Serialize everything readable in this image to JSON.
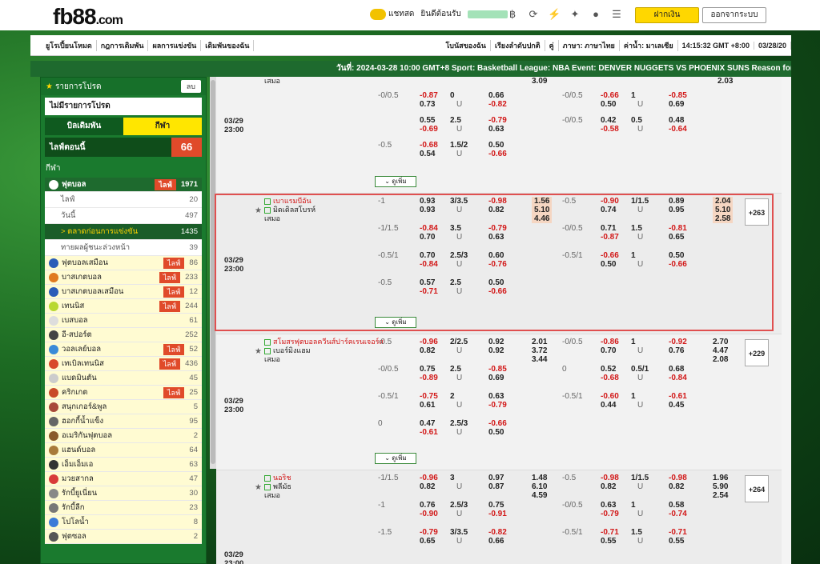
{
  "header": {
    "logo": "fb88",
    "logo_suffix": ".com",
    "chat": "แชทสด",
    "welcome": "ยินดีต้อนรับ",
    "deposit": "ฝากเงิน",
    "logout": "ออกจากระบบ"
  },
  "menu": [
    "ยูโรเปี้ยนโหมด",
    "กฎการเดิมพัน",
    "ผลการแข่งขัน",
    "เดิมพันของฉัน",
    "โบนัสของฉัน",
    "เรียงลำดับปกติ",
    "คู่",
    "ภาษา: ภาษาไทย",
    "ค่าน้ำ: มาเลเซีย",
    "14:15:32 GMT +8:00",
    "03/28/20"
  ],
  "ticker": "วันที่: 2024-03-28 10:00 GMT+8 Sport: Basketball League: NBA Event: DENVER NUGGETS VS PHOENIX SUNS Reason for cancellation",
  "sidebar": {
    "fav_title": "รายการโปรด",
    "fav_btn": "ลบ",
    "fav_empty": "ไม่มีรายการโปรด",
    "tab_bet": "บิลเดิมพัน",
    "tab_sport": "กีฬา",
    "live_label": "ไลฟ์ตอนนี้",
    "live_count": "66",
    "section": "กีฬา",
    "soccer": {
      "label": "ฟุตบอล",
      "live": "ไลฟ์",
      "count": "1971"
    },
    "sub": [
      {
        "label": "ไลฟ์",
        "count": "20"
      },
      {
        "label": "วันนี้",
        "count": "497"
      },
      {
        "label": "ตลาดก่อนการแข่งขัน",
        "count": "1435"
      },
      {
        "label": "ทายผลผู้ชนะล่วงหน้า",
        "count": "39"
      }
    ],
    "sports": [
      {
        "label": "ฟุตบอลเสมือน",
        "live": "ไลฟ์",
        "count": "86",
        "color": "#2a5cb8"
      },
      {
        "label": "บาสเกตบอล",
        "live": "ไลฟ์",
        "count": "233",
        "color": "#e07a20"
      },
      {
        "label": "บาสเกตบอลเสมือน",
        "live": "ไลฟ์",
        "count": "12",
        "color": "#2a5cb8"
      },
      {
        "label": "เทนนิส",
        "live": "ไลฟ์",
        "count": "244",
        "color": "#b8d830"
      },
      {
        "label": "เบสบอล",
        "live": "",
        "count": "61",
        "color": "#dddddd"
      },
      {
        "label": "อี-สปอร์ต",
        "live": "",
        "count": "252",
        "color": "#444444"
      },
      {
        "label": "วอลเลย์บอล",
        "live": "ไลฟ์",
        "count": "52",
        "color": "#3a8ad8"
      },
      {
        "label": "เทเบิลเทนนิส",
        "live": "ไลฟ์",
        "count": "436",
        "color": "#d84a2a"
      },
      {
        "label": "แบดมินตัน",
        "live": "",
        "count": "45",
        "color": "#cccccc"
      },
      {
        "label": "คริกเกต",
        "live": "ไลฟ์",
        "count": "25",
        "color": "#c84a2a"
      },
      {
        "label": "สนุกเกอร์&พูล",
        "live": "",
        "count": "5",
        "color": "#a84a3a"
      },
      {
        "label": "ฮอกกี้น้ำแข็ง",
        "live": "",
        "count": "95",
        "color": "#666666"
      },
      {
        "label": "อเมริกันฟุตบอล",
        "live": "",
        "count": "2",
        "color": "#8a5a2a"
      },
      {
        "label": "แฮนด์บอล",
        "live": "",
        "count": "64",
        "color": "#a87a3a"
      },
      {
        "label": "เอ็มเอ็มเอ",
        "live": "",
        "count": "63",
        "color": "#333333"
      },
      {
        "label": "มวยสากล",
        "live": "",
        "count": "47",
        "color": "#d83a3a"
      },
      {
        "label": "รักบี้ยูเนี่ยน",
        "live": "",
        "count": "30",
        "color": "#888888"
      },
      {
        "label": "รักบี้ลีก",
        "live": "",
        "count": "23",
        "color": "#777777"
      },
      {
        "label": "โปโลน้ำ",
        "live": "",
        "count": "8",
        "color": "#3a7ad8"
      },
      {
        "label": "ฟุตซอล",
        "live": "",
        "count": "2",
        "color": "#555555"
      }
    ]
  },
  "matches": [
    {
      "date": "03/29",
      "time": "23:00",
      "home": "",
      "away": "",
      "draw": "เสมอ",
      "more": "",
      "rows": [
        [
          "-0/0.5",
          "-0.87",
          "0.73",
          "0",
          "U",
          "0.66",
          "-0.82",
          "",
          "",
          "",
          "-0/0.5",
          "-0.66",
          "0.50",
          "1",
          "U",
          "-0.85",
          "0.69",
          "",
          "",
          ""
        ],
        [
          "",
          "0.55",
          "-0.69",
          "2.5",
          "U",
          "-0.79",
          "0.63",
          "",
          "",
          "",
          "-0/0.5",
          "0.42",
          "-0.58",
          "0.5",
          "U",
          "0.48",
          "-0.64",
          "",
          "",
          ""
        ],
        [
          "-0.5",
          "-0.68",
          "0.54",
          "1.5/2",
          "U",
          "0.50",
          "-0.66",
          "",
          "",
          "",
          "",
          "",
          "",
          "",
          "",
          "",
          "",
          "",
          "",
          ""
        ]
      ],
      "top1x2": [
        "3.09",
        ""
      ],
      "top_right": "2.03"
    },
    {
      "date": "03/29",
      "time": "23:00",
      "home": "เบาแรมบีอัน",
      "away": "มิดเดิลสโบรห์",
      "draw": "เสมอ",
      "more": "+263",
      "rows": [
        [
          "-1",
          "0.93",
          "0.93",
          "3/3.5",
          "U",
          "-0.98",
          "0.82",
          "1.56",
          "5.10",
          "4.46",
          "-0.5",
          "-0.90",
          "0.74",
          "1/1.5",
          "U",
          "0.89",
          "0.95",
          "2.04",
          "5.10",
          "2.58"
        ],
        [
          "-1/1.5",
          "-0.84",
          "0.70",
          "3.5",
          "U",
          "-0.79",
          "0.63",
          "",
          "",
          "",
          "-0/0.5",
          "0.71",
          "-0.87",
          "1.5",
          "U",
          "-0.81",
          "0.65",
          "",
          "",
          ""
        ],
        [
          "-0.5/1",
          "0.70",
          "-0.84",
          "2.5/3",
          "U",
          "0.60",
          "-0.76",
          "",
          "",
          "",
          "-0.5/1",
          "-0.66",
          "0.50",
          "1",
          "U",
          "0.50",
          "-0.66",
          "",
          "",
          ""
        ],
        [
          "-0.5",
          "0.57",
          "-0.71",
          "2.5",
          "U",
          "0.50",
          "-0.66",
          "",
          "",
          "",
          "",
          "",
          "",
          "",
          "",
          "",
          "",
          "",
          "",
          ""
        ]
      ]
    },
    {
      "date": "03/29",
      "time": "23:00",
      "home": "สโมสรฟุตบอลควีนส์ปาร์คเรนเจอร์ส",
      "away": "เบอร์มิงแฮม",
      "draw": "เสมอ",
      "more": "+229",
      "rows": [
        [
          "-0.5",
          "-0.96",
          "0.82",
          "2/2.5",
          "U",
          "0.92",
          "0.92",
          "2.01",
          "3.72",
          "3.44",
          "-0/0.5",
          "-0.86",
          "0.70",
          "1",
          "U",
          "-0.92",
          "0.76",
          "2.70",
          "4.47",
          "2.08"
        ],
        [
          "-0/0.5",
          "0.75",
          "-0.89",
          "2.5",
          "U",
          "-0.85",
          "0.69",
          "",
          "",
          "",
          "0",
          "0.52",
          "-0.68",
          "0.5/1",
          "U",
          "0.68",
          "-0.84",
          "",
          "",
          ""
        ],
        [
          "-0.5/1",
          "-0.75",
          "0.61",
          "2",
          "U",
          "0.63",
          "-0.79",
          "",
          "",
          "",
          "-0.5/1",
          "-0.60",
          "0.44",
          "1",
          "U",
          "-0.61",
          "0.45",
          "",
          "",
          ""
        ],
        [
          "0",
          "0.47",
          "-0.61",
          "2.5/3",
          "U",
          "-0.66",
          "0.50",
          "",
          "",
          "",
          "",
          "",
          "",
          "",
          "",
          "",
          "",
          "",
          "",
          ""
        ]
      ]
    },
    {
      "date": "03/29",
      "time": "23:00",
      "home": "นอริช",
      "away": "พลีมัธ",
      "draw": "เสมอ",
      "more": "+264",
      "rows": [
        [
          "-1/1.5",
          "-0.96",
          "0.82",
          "3",
          "U",
          "0.97",
          "0.87",
          "1.48",
          "6.10",
          "4.59",
          "-0.5",
          "-0.98",
          "0.82",
          "1/1.5",
          "U",
          "-0.98",
          "0.82",
          "1.96",
          "5.90",
          "2.54"
        ],
        [
          "-1",
          "0.76",
          "-0.90",
          "2.5/3",
          "U",
          "0.75",
          "-0.91",
          "",
          "",
          "",
          "-0/0.5",
          "0.63",
          "-0.79",
          "1",
          "U",
          "0.58",
          "-0.74",
          "",
          "",
          ""
        ],
        [
          "-1.5",
          "-0.79",
          "0.65",
          "3/3.5",
          "U",
          "-0.82",
          "0.66",
          "",
          "",
          "",
          "-0.5/1",
          "-0.71",
          "0.55",
          "1.5",
          "U",
          "-0.71",
          "0.55",
          "",
          "",
          ""
        ]
      ]
    }
  ],
  "expand_label": "ดูเพิ่ม"
}
